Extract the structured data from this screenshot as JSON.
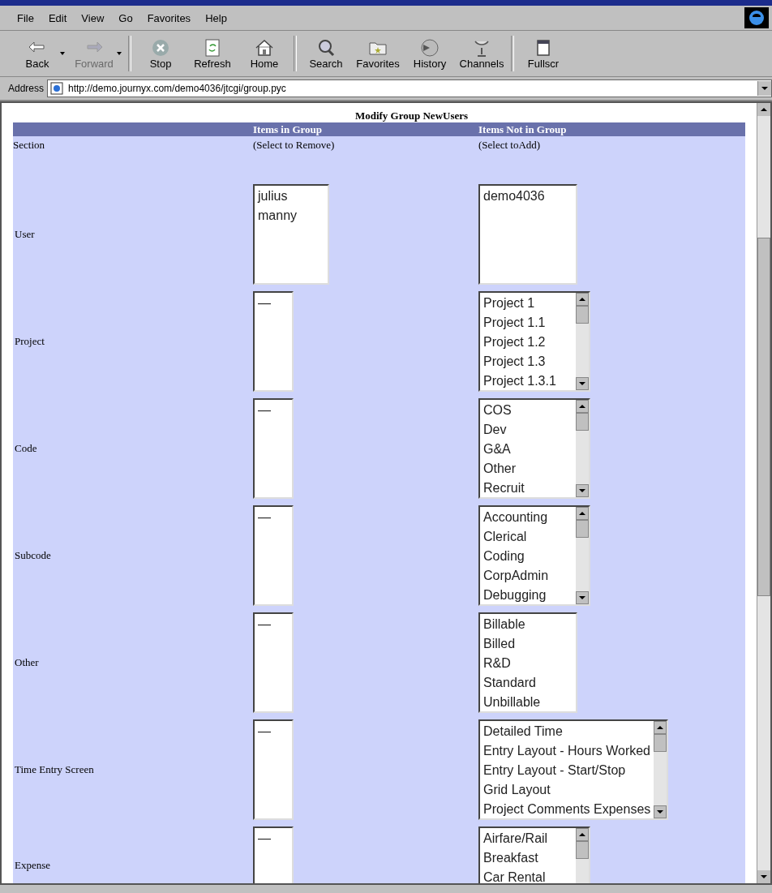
{
  "menu": [
    "File",
    "Edit",
    "View",
    "Go",
    "Favorites",
    "Help"
  ],
  "toolbar": [
    {
      "label": "Back",
      "disabled": false,
      "dropdown": true
    },
    {
      "label": "Forward",
      "disabled": true,
      "dropdown": true
    },
    {
      "label": "Stop",
      "disabled": false,
      "dropdown": false
    },
    {
      "label": "Refresh",
      "disabled": false,
      "dropdown": false
    },
    {
      "label": "Home",
      "disabled": false,
      "dropdown": false
    },
    {
      "label": "Search",
      "disabled": false,
      "dropdown": false
    },
    {
      "label": "Favorites",
      "disabled": false,
      "dropdown": false
    },
    {
      "label": "History",
      "disabled": false,
      "dropdown": false
    },
    {
      "label": "Channels",
      "disabled": false,
      "dropdown": false
    },
    {
      "label": "Fullscr",
      "disabled": false,
      "dropdown": false
    }
  ],
  "address": {
    "label": "Address",
    "value": "http://demo.journyx.com/demo4036/jtcgi/group.pyc"
  },
  "page": {
    "title": "Modify Group NewUsers",
    "columns": [
      "Items in Group",
      "Items Not in Group"
    ],
    "subheaders": [
      "Section",
      "(Select to Remove)",
      "(Select toAdd)"
    ],
    "rows": [
      {
        "label": "User",
        "in_group": {
          "items": [
            "julius",
            "manny"
          ],
          "scrollbar": false
        },
        "not_in_group": {
          "items": [
            "demo4036"
          ],
          "scrollbar": false
        }
      },
      {
        "label": "Project",
        "in_group": {
          "items": [
            "—"
          ],
          "scrollbar": false
        },
        "not_in_group": {
          "items": [
            "Project 1",
            "Project 1.1",
            "Project 1.2",
            "Project 1.3",
            "Project 1.3.1"
          ],
          "scrollbar": true
        }
      },
      {
        "label": "Code",
        "in_group": {
          "items": [
            "—"
          ],
          "scrollbar": false
        },
        "not_in_group": {
          "items": [
            "COS",
            "Dev",
            "G&A",
            "Other",
            "Recruit"
          ],
          "scrollbar": true
        }
      },
      {
        "label": "Subcode",
        "in_group": {
          "items": [
            "—"
          ],
          "scrollbar": false
        },
        "not_in_group": {
          "items": [
            "Accounting",
            "Clerical",
            "Coding",
            "CorpAdmin",
            "Debugging"
          ],
          "scrollbar": true
        }
      },
      {
        "label": "Other",
        "in_group": {
          "items": [
            "—"
          ],
          "scrollbar": false
        },
        "not_in_group": {
          "items": [
            "Billable",
            "Billed",
            "R&D",
            "Standard",
            "Unbillable"
          ],
          "scrollbar": false
        }
      },
      {
        "label": "Time Entry Screen",
        "in_group": {
          "items": [
            "—"
          ],
          "scrollbar": false
        },
        "not_in_group": {
          "items": [
            "Detailed Time",
            "Entry Layout - Hours Worked",
            "Entry Layout - Start/Stop",
            "Grid Layout",
            "Project Comments Expenses"
          ],
          "scrollbar": true
        }
      },
      {
        "label": "Expense",
        "in_group": {
          "items": [
            "—"
          ],
          "scrollbar": false
        },
        "not_in_group": {
          "items": [
            "Airfare/Rail",
            "Breakfast",
            "Car Rental"
          ],
          "scrollbar": true
        }
      }
    ]
  }
}
